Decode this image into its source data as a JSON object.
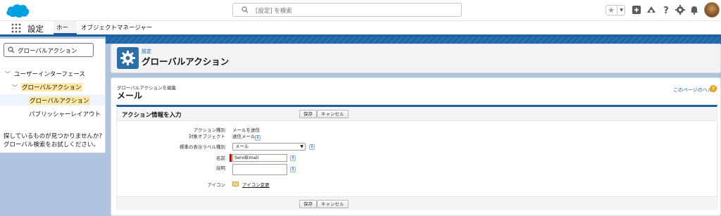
{
  "header": {
    "search_placeholder": "[設定] を検索"
  },
  "context_bar": {
    "app_name": "設定",
    "tabs": [
      "ホーム",
      "オブジェクトマネージャー"
    ]
  },
  "sidebar": {
    "quickfind_value": "グローバルアクション",
    "tree": {
      "section": "ユーザーインターフェース",
      "group": "グローバルアクション",
      "items": [
        "グローバルアクション",
        "パブリッシャーレイアウト"
      ]
    },
    "help_text_line1": "探しているものが見つかりませんか?",
    "help_text_line2": "グローバル検索をお試しください。"
  },
  "page_header": {
    "breadcrumb": "設定",
    "title": "グローバルアクション"
  },
  "content": {
    "edit_caption": "グローバルアクションを編集",
    "edit_title": "メール",
    "help_link": "このページのヘルプ",
    "section_title": "アクション情報を入力",
    "save_label": "保存",
    "cancel_label": "キャンセル",
    "fields": {
      "action_type_label": "アクション種別",
      "action_type_value": "メールを送信",
      "target_object_label": "対象オブジェクト",
      "target_object_value": "送信メール",
      "standard_label_type_label": "標準の表示ラベル種別",
      "standard_label_type_value": "メール",
      "name_label": "名前",
      "name_value": "SendEmail",
      "description_label": "説明",
      "description_value": "",
      "icon_label": "アイコン",
      "icon_link": "アイコン変更"
    }
  },
  "colors": {
    "brand_blue": "#1b5f9e",
    "highlight": "#fde8a6",
    "background_band": "#b0c4df"
  }
}
